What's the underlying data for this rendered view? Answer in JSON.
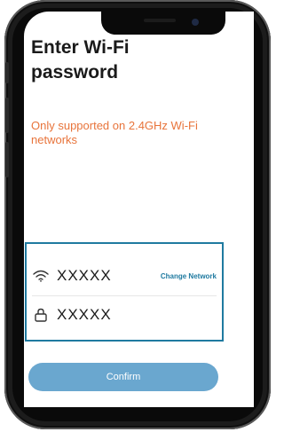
{
  "screen": {
    "title": "Enter Wi-Fi password",
    "subtitle": "Only supported on 2.4GHz Wi-Fi networks"
  },
  "network": {
    "ssid_value": "XXXXX",
    "ssid_icon": "wifi-icon",
    "change_label": "Change Network"
  },
  "password": {
    "value": "XXXXX",
    "icon": "lock-icon"
  },
  "confirm_label": "Confirm",
  "colors": {
    "accent": "#1f7aa0",
    "warning": "#e8743b",
    "button": "#6aa7cf"
  }
}
